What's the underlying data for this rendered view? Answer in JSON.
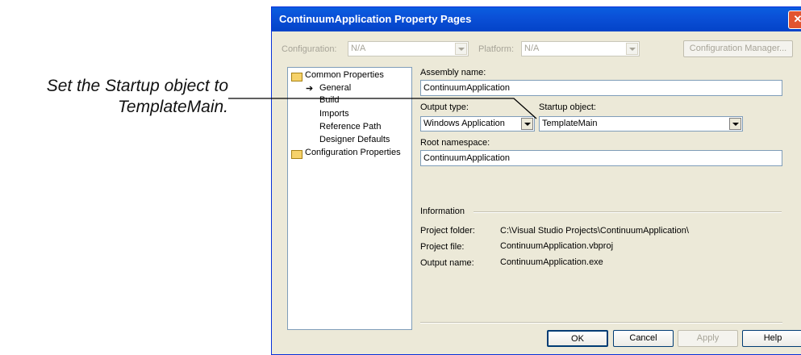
{
  "callout": {
    "line1": "Set the Startup object to",
    "line2": "TemplateMain."
  },
  "window": {
    "title": "ContinuumApplication Property Pages",
    "close": "✕"
  },
  "toolbar": {
    "configuration_label": "Configuration:",
    "configuration_value": "N/A",
    "platform_label": "Platform:",
    "platform_value": "N/A",
    "config_manager_label": "Configuration Manager..."
  },
  "tree": {
    "root1": "Common Properties",
    "children": [
      "General",
      "Build",
      "Imports",
      "Reference Path",
      "Designer Defaults"
    ],
    "root2": "Configuration Properties"
  },
  "form": {
    "assembly_name_label": "Assembly name:",
    "assembly_name_value": "ContinuumApplication",
    "output_type_label": "Output type:",
    "output_type_value": "Windows Application",
    "startup_object_label": "Startup object:",
    "startup_object_value": "TemplateMain",
    "root_namespace_label": "Root namespace:",
    "root_namespace_value": "ContinuumApplication"
  },
  "info": {
    "header": "Information",
    "rows": [
      {
        "label": "Project folder:",
        "value": "C:\\Visual Studio Projects\\ContinuumApplication\\"
      },
      {
        "label": "Project file:",
        "value": "ContinuumApplication.vbproj"
      },
      {
        "label": "Output name:",
        "value": "ContinuumApplication.exe"
      }
    ]
  },
  "buttons": {
    "ok": "OK",
    "cancel": "Cancel",
    "apply": "Apply",
    "help": "Help"
  },
  "colors": {
    "titlebar": "#0a4fd6",
    "dialog_bg": "#ece9d8",
    "close_button": "#e2542f"
  }
}
